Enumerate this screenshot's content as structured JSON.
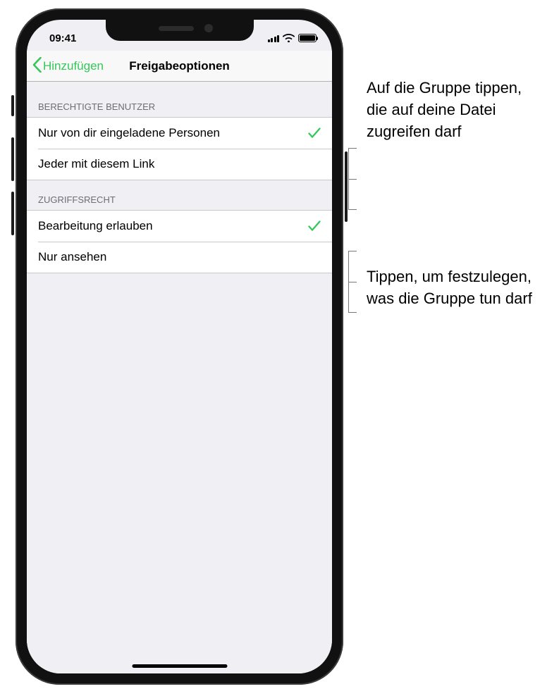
{
  "status": {
    "time": "09:41"
  },
  "nav": {
    "back_label": "Hinzufügen",
    "title": "Freigabeoptionen"
  },
  "sections": [
    {
      "header": "Berechtigte Benutzer",
      "rows": [
        {
          "label": "Nur von dir eingeladene Personen",
          "selected": true
        },
        {
          "label": "Jeder mit diesem Link",
          "selected": false
        }
      ]
    },
    {
      "header": "Zugriffsrecht",
      "rows": [
        {
          "label": "Bearbeitung erlauben",
          "selected": true
        },
        {
          "label": "Nur ansehen",
          "selected": false
        }
      ]
    }
  ],
  "callouts": {
    "top": "Auf die Gruppe tippen, die auf deine Datei zugreifen darf",
    "bottom": "Tippen, um festzulegen, was die Gruppe tun darf"
  }
}
